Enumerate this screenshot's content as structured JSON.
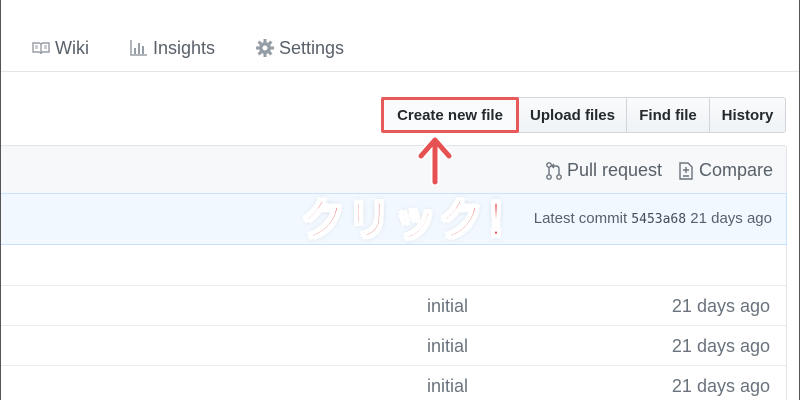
{
  "nav": {
    "items": [
      {
        "label": "Wiki",
        "icon": "book-icon"
      },
      {
        "label": "Insights",
        "icon": "graph-icon"
      },
      {
        "label": "Settings",
        "icon": "gear-icon"
      }
    ]
  },
  "buttons": {
    "create": "Create new file",
    "upload": "Upload files",
    "find": "Find file",
    "history": "History"
  },
  "toolbar": {
    "pull_request": "Pull request",
    "compare": "Compare"
  },
  "commit": {
    "prefix": "Latest commit",
    "sha": "5453a68",
    "age": "21 days ago"
  },
  "files": [
    {
      "message": "initial",
      "age": "21 days ago"
    },
    {
      "message": "initial",
      "age": "21 days ago"
    },
    {
      "message": "initial",
      "age": "21 days ago"
    }
  ],
  "annotation": {
    "text": "クリック！",
    "color": "#e65252"
  },
  "colors": {
    "highlight": "#e85a5a",
    "commit_bg": "#f1f8ff"
  }
}
